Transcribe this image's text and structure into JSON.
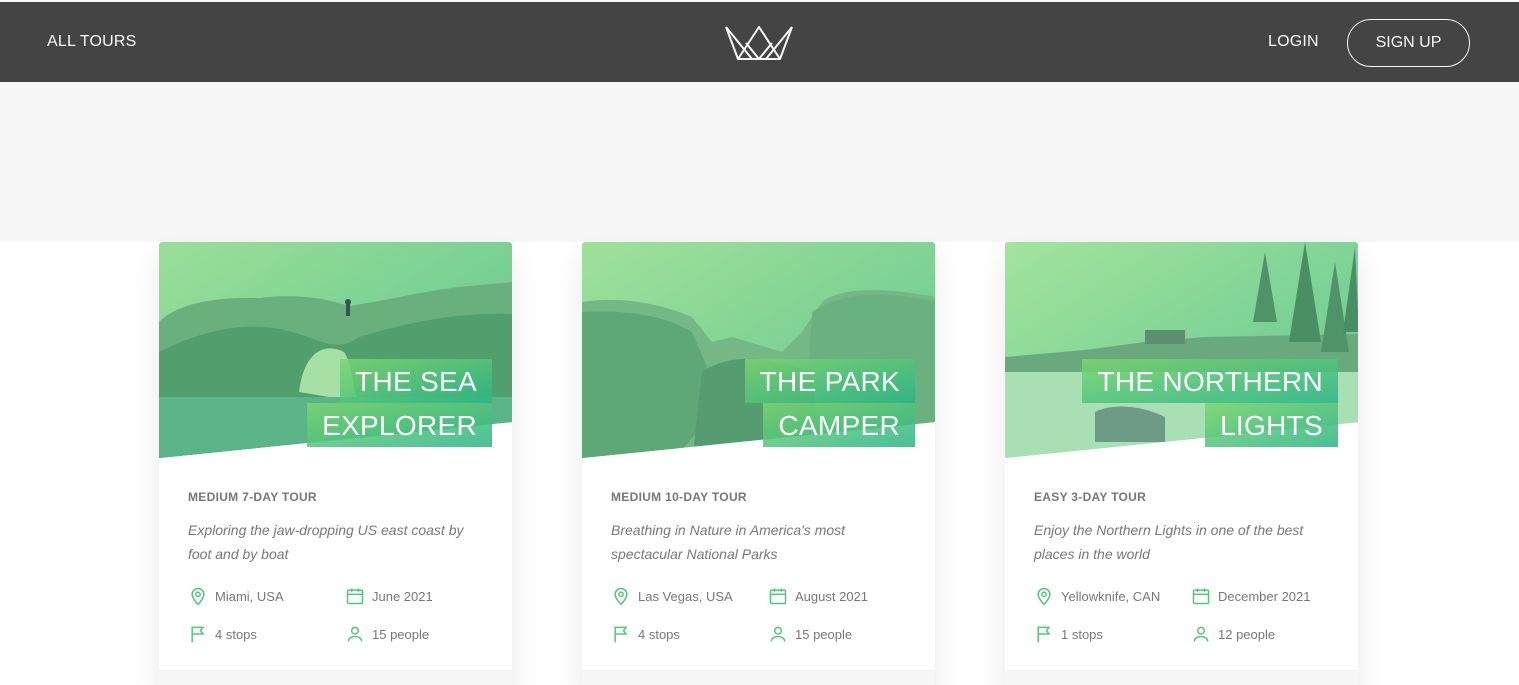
{
  "header": {
    "all_tours": "ALL TOURS",
    "login": "LOGIN",
    "signup": "SIGN UP",
    "logo_icon": "crown-logo-icon"
  },
  "colors": {
    "header_bg": "#444444",
    "accent_light": "#7dd56f",
    "accent_dark": "#28b487",
    "page_bg": "#f7f7f7"
  },
  "cards": [
    {
      "title_line1": "THE SEA",
      "title_line2": "EXPLORER",
      "subheading": "MEDIUM 7-DAY TOUR",
      "description": "Exploring the jaw-dropping US east coast by foot and by boat",
      "location": "Miami, USA",
      "date": "June 2021",
      "stops": "4 stops",
      "people": "15 people"
    },
    {
      "title_line1": "THE PARK",
      "title_line2": "CAMPER",
      "subheading": "MEDIUM 10-DAY TOUR",
      "description": "Breathing in Nature in America's most spectacular National Parks",
      "location": "Las Vegas, USA",
      "date": "August 2021",
      "stops": "4 stops",
      "people": "15 people"
    },
    {
      "title_line1": "THE NORTHERN",
      "title_line2": "LIGHTS",
      "subheading": "EASY 3-DAY TOUR",
      "description": "Enjoy the Northern Lights in one of the best places in the world",
      "location": "Yellowknife, CAN",
      "date": "December 2021",
      "stops": "1 stops",
      "people": "12 people"
    }
  ],
  "icons": {
    "location": "map-pin-icon",
    "date": "calendar-icon",
    "stops": "flag-icon",
    "people": "user-icon"
  }
}
